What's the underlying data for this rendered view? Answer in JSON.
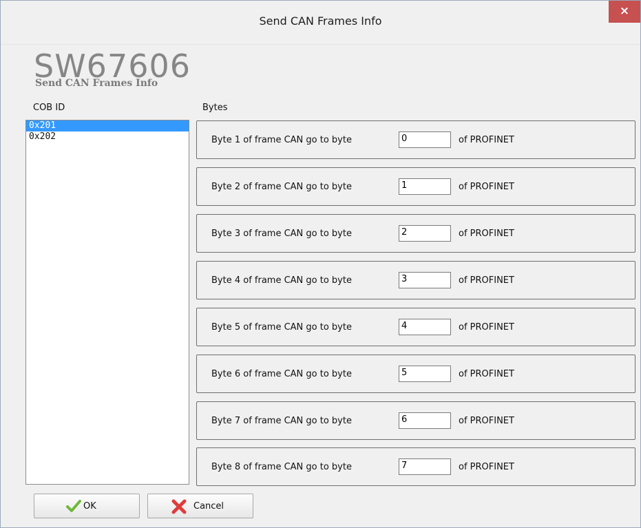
{
  "window": {
    "title": "Send CAN Frames Info",
    "close_label": "×"
  },
  "header": {
    "brand": "SW67606",
    "subtitle": "Send CAN Frames Info"
  },
  "cob": {
    "label": "COB ID",
    "items": [
      "0x201",
      "0x202"
    ],
    "selected": "0x201"
  },
  "bytes": {
    "label": "Bytes",
    "rows": [
      {
        "prefix": "Byte 1 of frame CAN go to byte",
        "value": "0",
        "suffix": "of PROFINET"
      },
      {
        "prefix": "Byte 2 of frame CAN go to byte",
        "value": "1",
        "suffix": "of PROFINET"
      },
      {
        "prefix": "Byte 3 of frame CAN go to byte",
        "value": "2",
        "suffix": "of PROFINET"
      },
      {
        "prefix": "Byte 4 of frame CAN go to byte",
        "value": "3",
        "suffix": "of PROFINET"
      },
      {
        "prefix": "Byte 5 of frame CAN go to byte",
        "value": "4",
        "suffix": "of PROFINET"
      },
      {
        "prefix": "Byte 6 of frame CAN go to byte",
        "value": "5",
        "suffix": "of PROFINET"
      },
      {
        "prefix": "Byte 7 of frame CAN go to byte",
        "value": "6",
        "suffix": "of PROFINET"
      },
      {
        "prefix": "Byte 8 of frame CAN go to byte",
        "value": "7",
        "suffix": "of PROFINET"
      }
    ]
  },
  "buttons": {
    "ok_label": "OK",
    "cancel_label": "Cancel"
  },
  "icons": {
    "ok": "checkmark-icon",
    "cancel": "red-x-icon"
  },
  "colors": {
    "selection": "#3399ff",
    "close": "#c75050",
    "check": "#6fb83a",
    "cross": "#e03b3b"
  }
}
